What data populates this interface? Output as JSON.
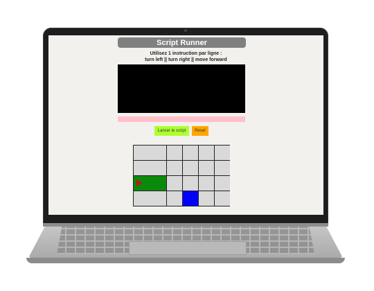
{
  "app": {
    "title": "Script Runner",
    "instructions_line1": "Utilisez 1 instruction par ligne :",
    "instructions_line2": "turn left || turn right || move forward"
  },
  "editor": {
    "value": "",
    "placeholder": ""
  },
  "error_message": "",
  "buttons": {
    "run_label": "Lancer le script",
    "reset_label": "Reset"
  },
  "grid": {
    "rows": 4,
    "cols": 5,
    "robot": {
      "row": 3,
      "col": 1,
      "facing": "right"
    },
    "goal": {
      "row": 4,
      "col": 3
    }
  },
  "colors": {
    "title_bg": "#808080",
    "editor_bg": "#000000",
    "error_bg": "#ffc0cb",
    "run_button": "#adff2f",
    "reset_button": "#ffa500",
    "robot_cell": "#0a8a0a",
    "robot_arrow": "#c1121f",
    "goal_cell": "#0000ff",
    "empty_cell": "#d9d9d9"
  }
}
